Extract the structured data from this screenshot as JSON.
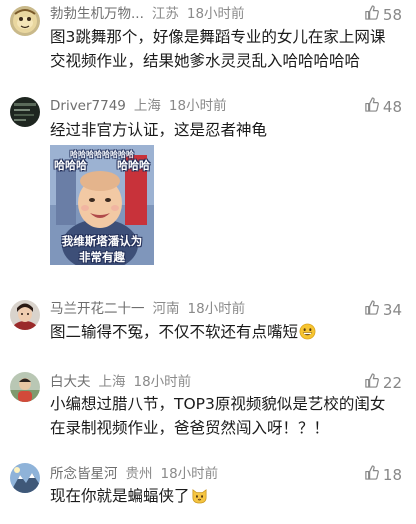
{
  "comments": [
    {
      "username": "勃勃生机万物...",
      "location": "江苏",
      "time": "18小时前",
      "likes": "58",
      "text": "图3跳舞那个，好像是舞蹈专业的女儿在家上网课交视频作业，结果她爹水灵灵乱入哈哈哈哈哈",
      "avatar": "avatar-cartoon-icon"
    },
    {
      "username": "Driver7749",
      "location": "上海",
      "time": "18小时前",
      "likes": "48",
      "text": "经过非官方认证，这是忍者神龟",
      "avatar": "avatar-dark-icon",
      "image": {
        "top_left": "哈哈哈",
        "top_right": "哈哈哈",
        "pattern": "哈哈哈哈哈哈哈哈",
        "caption_line1": "我维斯塔潘认为",
        "caption_line2": "非常有趣"
      }
    },
    {
      "username": "马兰开花二十一",
      "location": "河南",
      "time": "18小时前",
      "likes": "34",
      "text": "图二输得不冤，不仅不软还有点嘴短",
      "avatar": "avatar-portrait-icon",
      "emoji": "grinning-emoji-icon"
    },
    {
      "username": "白大夫",
      "location": "上海",
      "time": "18小时前",
      "likes": "22",
      "text": "小编想过腊八节，TOP3原视频貌似是艺校的闺女在录制视频作业，爸爸贸然闯入呀！？！",
      "avatar": "avatar-person-icon"
    },
    {
      "username": "所念皆星河",
      "location": "贵州",
      "time": "18小时前",
      "likes": "18",
      "text": "现在你就是蝙蝠侠了",
      "avatar": "avatar-mountain-icon",
      "emoji": "cat-emoji-icon"
    }
  ],
  "colors": {
    "meta": "#8a8a8a",
    "text": "#1a1a1a",
    "like": "#888888"
  }
}
